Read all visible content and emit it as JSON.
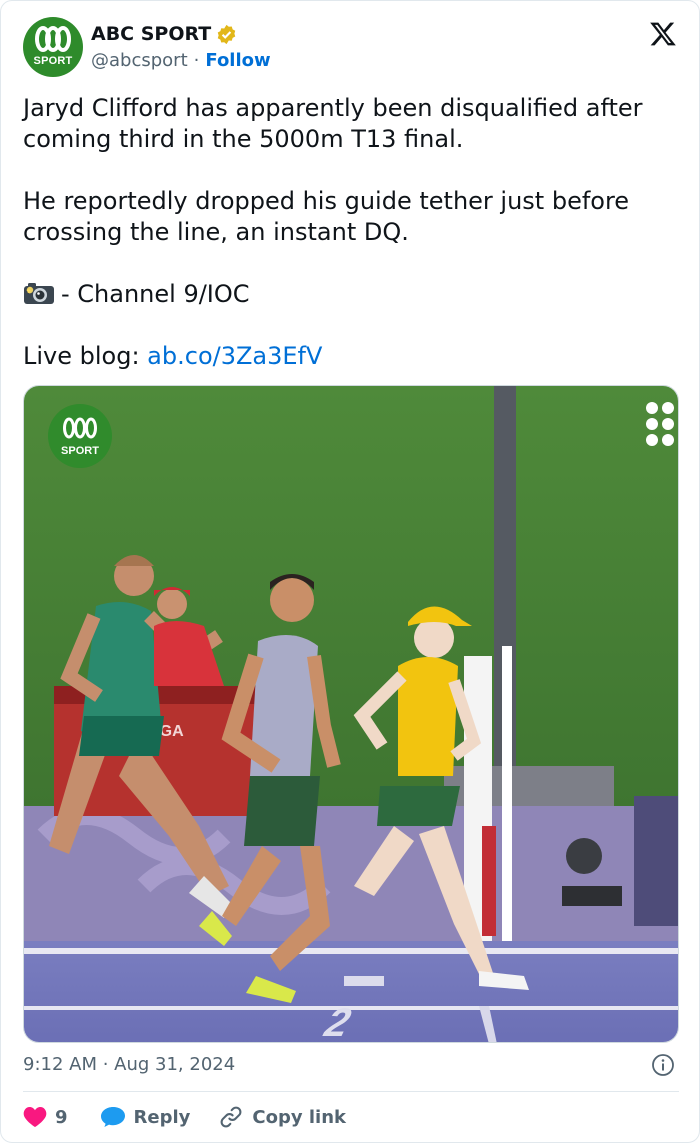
{
  "author": {
    "name": "ABC SPORT",
    "handle": "@abcsport",
    "separator": "·",
    "follow_label": "Follow",
    "avatar_text": "SPORT",
    "verified_badge_icon": "gold-check-badge-icon"
  },
  "tweet": {
    "paragraph1": "Jaryd Clifford has apparently been disqualified after coming third in the 5000m T13  final.",
    "paragraph2": "He reportedly dropped his guide tether just before crossing the line, an instant DQ.",
    "credit_text": "- Channel 9/IOC",
    "live_blog_label": "Live blog: ",
    "live_blog_link": "ab.co/3Za3EfV"
  },
  "media": {
    "watermark_text": "SPORT",
    "track_lane_number": "2",
    "board_text": "EGA"
  },
  "footer": {
    "timestamp": "9:12 AM · Aug 31, 2024",
    "likes_count": "9",
    "reply_label": "Reply",
    "copy_link_label": "Copy link"
  },
  "colors": {
    "like": "#f91880",
    "reply": "#1d9bf0",
    "link": "#006fd6",
    "abc_green": "#2e8b2b"
  }
}
